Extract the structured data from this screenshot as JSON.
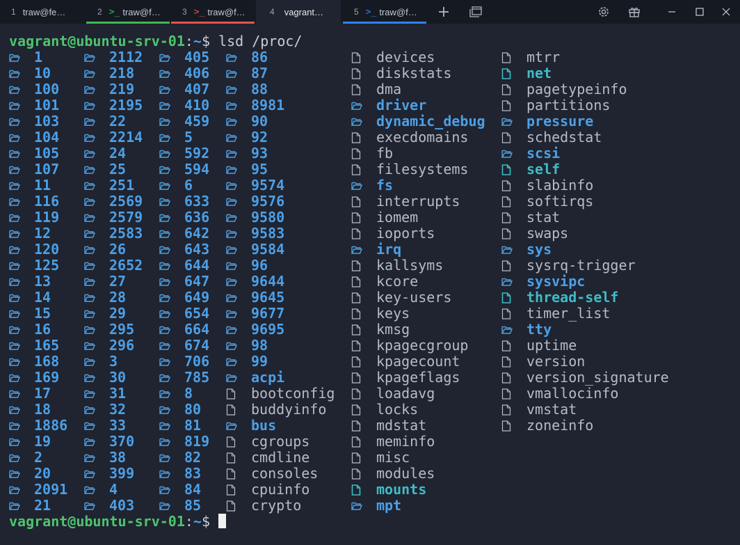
{
  "tabs": [
    {
      "num": "1",
      "label": "traw@fe…",
      "icon": "",
      "active": false,
      "bar": ""
    },
    {
      "num": "2",
      "label": "traw@f…",
      "icon": ">_",
      "active": false,
      "bar": "#3fb950"
    },
    {
      "num": "3",
      "label": "traw@f…",
      "icon": ">_",
      "active": false,
      "bar": "#e5534b"
    },
    {
      "num": "4",
      "label": "vagrant…",
      "icon": "",
      "active": true,
      "bar": ""
    },
    {
      "num": "5",
      "label": "traw@f…",
      "icon": ">_",
      "active": false,
      "bar": "#2f81f7"
    }
  ],
  "titlebar": {
    "new_tab": "+",
    "tab_list": "⧉",
    "settings": "⚙",
    "gift": "🎁",
    "minimize": "─",
    "maximize": "☐",
    "close": "✕"
  },
  "prompt": {
    "user_host": "vagrant@ubuntu-srv-01",
    "colon": ":",
    "path": "~",
    "dollar": "$"
  },
  "command": "lsd /proc/",
  "icons": {
    "dir": "folder-open-icon",
    "file": "file-icon",
    "link": "file-link-icon"
  },
  "columns": [
    [
      {
        "n": "1",
        "t": "d"
      },
      {
        "n": "10",
        "t": "d"
      },
      {
        "n": "100",
        "t": "d"
      },
      {
        "n": "101",
        "t": "d"
      },
      {
        "n": "103",
        "t": "d"
      },
      {
        "n": "104",
        "t": "d"
      },
      {
        "n": "105",
        "t": "d"
      },
      {
        "n": "107",
        "t": "d"
      },
      {
        "n": "11",
        "t": "d"
      },
      {
        "n": "116",
        "t": "d"
      },
      {
        "n": "119",
        "t": "d"
      },
      {
        "n": "12",
        "t": "d"
      },
      {
        "n": "120",
        "t": "d"
      },
      {
        "n": "125",
        "t": "d"
      },
      {
        "n": "13",
        "t": "d"
      },
      {
        "n": "14",
        "t": "d"
      },
      {
        "n": "15",
        "t": "d"
      },
      {
        "n": "16",
        "t": "d"
      },
      {
        "n": "165",
        "t": "d"
      },
      {
        "n": "168",
        "t": "d"
      },
      {
        "n": "169",
        "t": "d"
      },
      {
        "n": "17",
        "t": "d"
      },
      {
        "n": "18",
        "t": "d"
      },
      {
        "n": "1886",
        "t": "d"
      },
      {
        "n": "19",
        "t": "d"
      },
      {
        "n": "2",
        "t": "d"
      },
      {
        "n": "20",
        "t": "d"
      },
      {
        "n": "2091",
        "t": "d"
      },
      {
        "n": "21",
        "t": "d"
      }
    ],
    [
      {
        "n": "2112",
        "t": "d"
      },
      {
        "n": "218",
        "t": "d"
      },
      {
        "n": "219",
        "t": "d"
      },
      {
        "n": "2195",
        "t": "d"
      },
      {
        "n": "22",
        "t": "d"
      },
      {
        "n": "2214",
        "t": "d"
      },
      {
        "n": "24",
        "t": "d"
      },
      {
        "n": "25",
        "t": "d"
      },
      {
        "n": "251",
        "t": "d"
      },
      {
        "n": "2569",
        "t": "d"
      },
      {
        "n": "2579",
        "t": "d"
      },
      {
        "n": "2583",
        "t": "d"
      },
      {
        "n": "26",
        "t": "d"
      },
      {
        "n": "2652",
        "t": "d"
      },
      {
        "n": "27",
        "t": "d"
      },
      {
        "n": "28",
        "t": "d"
      },
      {
        "n": "29",
        "t": "d"
      },
      {
        "n": "295",
        "t": "d"
      },
      {
        "n": "296",
        "t": "d"
      },
      {
        "n": "3",
        "t": "d"
      },
      {
        "n": "30",
        "t": "d"
      },
      {
        "n": "31",
        "t": "d"
      },
      {
        "n": "32",
        "t": "d"
      },
      {
        "n": "33",
        "t": "d"
      },
      {
        "n": "370",
        "t": "d"
      },
      {
        "n": "38",
        "t": "d"
      },
      {
        "n": "399",
        "t": "d"
      },
      {
        "n": "4",
        "t": "d"
      },
      {
        "n": "403",
        "t": "d"
      }
    ],
    [
      {
        "n": "405",
        "t": "d"
      },
      {
        "n": "406",
        "t": "d"
      },
      {
        "n": "407",
        "t": "d"
      },
      {
        "n": "410",
        "t": "d"
      },
      {
        "n": "459",
        "t": "d"
      },
      {
        "n": "5",
        "t": "d"
      },
      {
        "n": "592",
        "t": "d"
      },
      {
        "n": "594",
        "t": "d"
      },
      {
        "n": "6",
        "t": "d"
      },
      {
        "n": "633",
        "t": "d"
      },
      {
        "n": "636",
        "t": "d"
      },
      {
        "n": "642",
        "t": "d"
      },
      {
        "n": "643",
        "t": "d"
      },
      {
        "n": "644",
        "t": "d"
      },
      {
        "n": "647",
        "t": "d"
      },
      {
        "n": "649",
        "t": "d"
      },
      {
        "n": "654",
        "t": "d"
      },
      {
        "n": "664",
        "t": "d"
      },
      {
        "n": "674",
        "t": "d"
      },
      {
        "n": "706",
        "t": "d"
      },
      {
        "n": "785",
        "t": "d"
      },
      {
        "n": "8",
        "t": "d"
      },
      {
        "n": "80",
        "t": "d"
      },
      {
        "n": "81",
        "t": "d"
      },
      {
        "n": "819",
        "t": "d"
      },
      {
        "n": "82",
        "t": "d"
      },
      {
        "n": "83",
        "t": "d"
      },
      {
        "n": "84",
        "t": "d"
      },
      {
        "n": "85",
        "t": "d"
      }
    ],
    [
      {
        "n": "86",
        "t": "d"
      },
      {
        "n": "87",
        "t": "d"
      },
      {
        "n": "88",
        "t": "d"
      },
      {
        "n": "8981",
        "t": "d"
      },
      {
        "n": "90",
        "t": "d"
      },
      {
        "n": "92",
        "t": "d"
      },
      {
        "n": "93",
        "t": "d"
      },
      {
        "n": "95",
        "t": "d"
      },
      {
        "n": "9574",
        "t": "d"
      },
      {
        "n": "9576",
        "t": "d"
      },
      {
        "n": "9580",
        "t": "d"
      },
      {
        "n": "9583",
        "t": "d"
      },
      {
        "n": "9584",
        "t": "d"
      },
      {
        "n": "96",
        "t": "d"
      },
      {
        "n": "9644",
        "t": "d"
      },
      {
        "n": "9645",
        "t": "d"
      },
      {
        "n": "9677",
        "t": "d"
      },
      {
        "n": "9695",
        "t": "d"
      },
      {
        "n": "98",
        "t": "d"
      },
      {
        "n": "99",
        "t": "d"
      },
      {
        "n": "acpi",
        "t": "d"
      },
      {
        "n": "bootconfig",
        "t": "f"
      },
      {
        "n": "buddyinfo",
        "t": "f"
      },
      {
        "n": "bus",
        "t": "d"
      },
      {
        "n": "cgroups",
        "t": "f"
      },
      {
        "n": "cmdline",
        "t": "f"
      },
      {
        "n": "consoles",
        "t": "f"
      },
      {
        "n": "cpuinfo",
        "t": "f"
      },
      {
        "n": "crypto",
        "t": "f"
      }
    ],
    [
      {
        "n": "devices",
        "t": "f"
      },
      {
        "n": "diskstats",
        "t": "f"
      },
      {
        "n": "dma",
        "t": "f"
      },
      {
        "n": "driver",
        "t": "d"
      },
      {
        "n": "dynamic_debug",
        "t": "d"
      },
      {
        "n": "execdomains",
        "t": "f"
      },
      {
        "n": "fb",
        "t": "f"
      },
      {
        "n": "filesystems",
        "t": "f"
      },
      {
        "n": "fs",
        "t": "d"
      },
      {
        "n": "interrupts",
        "t": "f"
      },
      {
        "n": "iomem",
        "t": "f"
      },
      {
        "n": "ioports",
        "t": "f"
      },
      {
        "n": "irq",
        "t": "d"
      },
      {
        "n": "kallsyms",
        "t": "f"
      },
      {
        "n": "kcore",
        "t": "f"
      },
      {
        "n": "key-users",
        "t": "f"
      },
      {
        "n": "keys",
        "t": "f"
      },
      {
        "n": "kmsg",
        "t": "f"
      },
      {
        "n": "kpagecgroup",
        "t": "f"
      },
      {
        "n": "kpagecount",
        "t": "f"
      },
      {
        "n": "kpageflags",
        "t": "f"
      },
      {
        "n": "loadavg",
        "t": "f"
      },
      {
        "n": "locks",
        "t": "f"
      },
      {
        "n": "mdstat",
        "t": "f"
      },
      {
        "n": "meminfo",
        "t": "f"
      },
      {
        "n": "misc",
        "t": "f"
      },
      {
        "n": "modules",
        "t": "f"
      },
      {
        "n": "mounts",
        "t": "l"
      },
      {
        "n": "mpt",
        "t": "d"
      }
    ],
    [
      {
        "n": "mtrr",
        "t": "f"
      },
      {
        "n": "net",
        "t": "l"
      },
      {
        "n": "pagetypeinfo",
        "t": "f"
      },
      {
        "n": "partitions",
        "t": "f"
      },
      {
        "n": "pressure",
        "t": "d"
      },
      {
        "n": "schedstat",
        "t": "f"
      },
      {
        "n": "scsi",
        "t": "d"
      },
      {
        "n": "self",
        "t": "l"
      },
      {
        "n": "slabinfo",
        "t": "f"
      },
      {
        "n": "softirqs",
        "t": "f"
      },
      {
        "n": "stat",
        "t": "f"
      },
      {
        "n": "swaps",
        "t": "f"
      },
      {
        "n": "sys",
        "t": "d"
      },
      {
        "n": "sysrq-trigger",
        "t": "f"
      },
      {
        "n": "sysvipc",
        "t": "d"
      },
      {
        "n": "thread-self",
        "t": "l"
      },
      {
        "n": "timer_list",
        "t": "f"
      },
      {
        "n": "tty",
        "t": "d"
      },
      {
        "n": "uptime",
        "t": "f"
      },
      {
        "n": "version",
        "t": "f"
      },
      {
        "n": "version_signature",
        "t": "f"
      },
      {
        "n": "vmallocinfo",
        "t": "f"
      },
      {
        "n": "vmstat",
        "t": "f"
      },
      {
        "n": "zoneinfo",
        "t": "f"
      }
    ]
  ],
  "colors": {
    "background": "#1f2430",
    "dir": "#4d9fe6",
    "link": "#3fbcc6",
    "file": "#b6bcc6",
    "prompt_user": "#4fc46e"
  }
}
